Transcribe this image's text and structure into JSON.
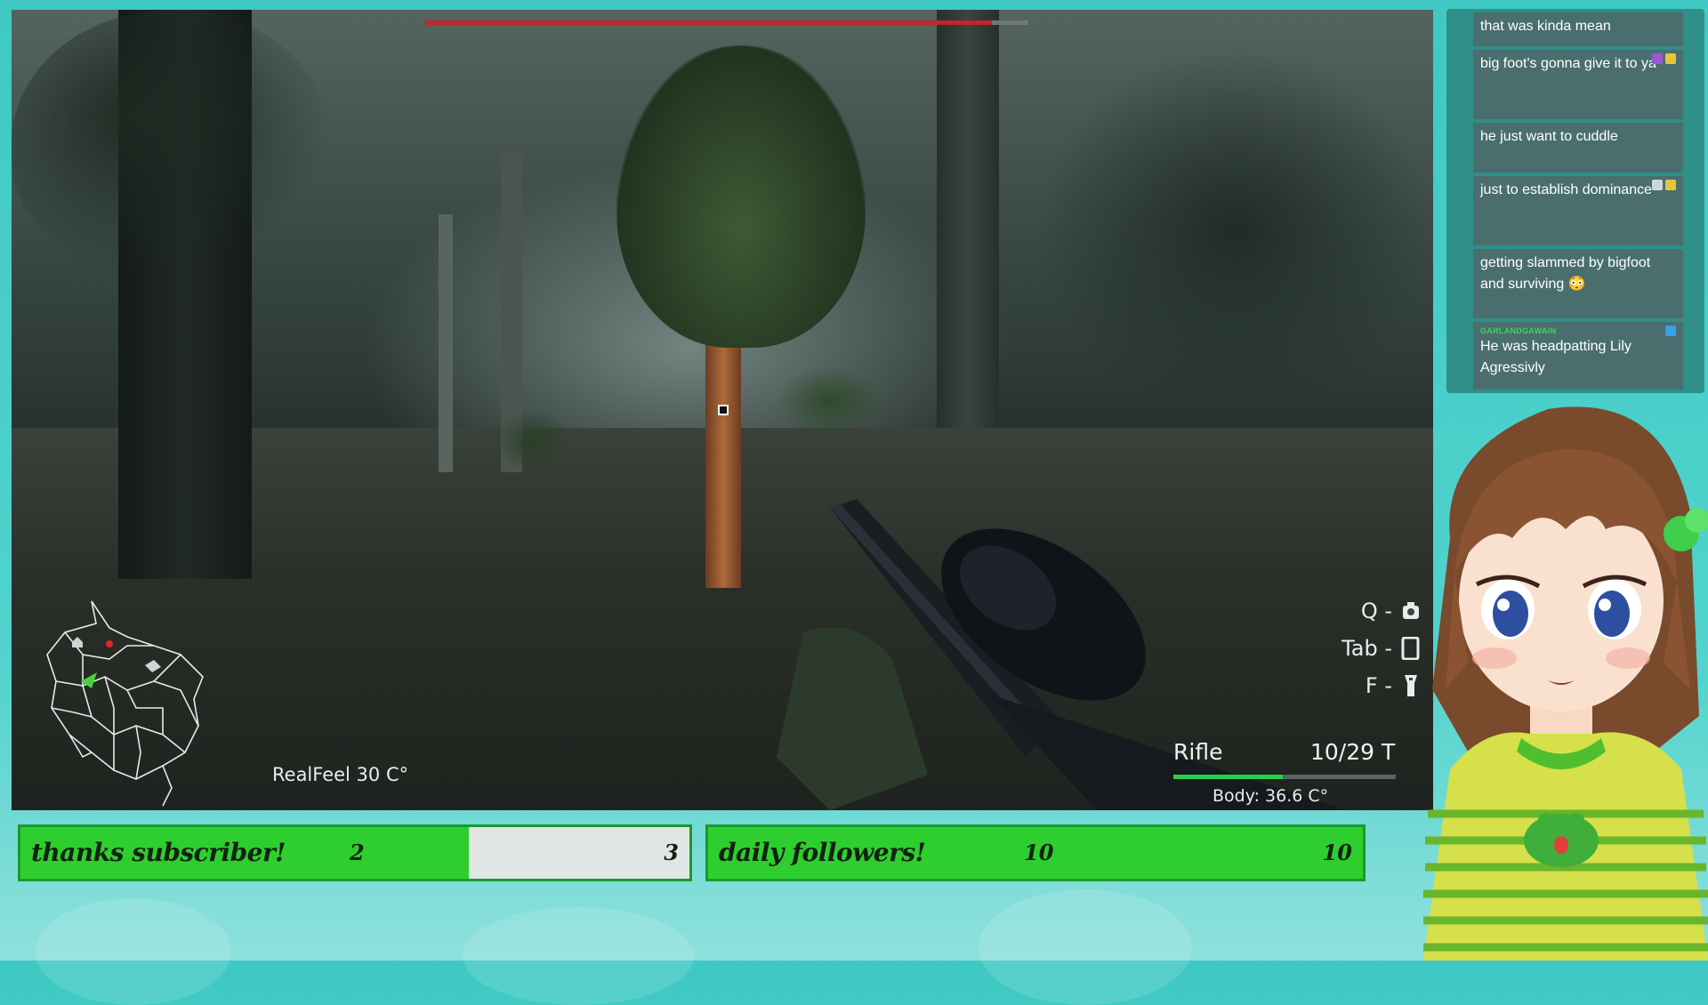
{
  "game": {
    "boss_health_pct": 94,
    "realfeel": "RealFeel  30  C°",
    "hotkeys": [
      {
        "key": "Q -",
        "icon": "camera-icon"
      },
      {
        "key": "Tab -",
        "icon": "phone-icon"
      },
      {
        "key": "F -",
        "icon": "flashlight-icon"
      }
    ],
    "weapon": "Rifle",
    "ammo": "10/29 T",
    "health_pct": 49,
    "body_temp": "Body:  36.6  C°"
  },
  "goals": [
    {
      "label": "thanks subscriber!",
      "current": "2",
      "target": "3",
      "progress": 0.67
    },
    {
      "label": "daily followers!",
      "current": "10",
      "target": "10",
      "progress": 1.0
    }
  ],
  "chat": {
    "messages": [
      {
        "user": "",
        "text": "that was kinda mean"
      },
      {
        "user": "",
        "text": "big foot's gonna give it to ya",
        "badges": [
          "#9b59d0",
          "#e8c43a"
        ]
      },
      {
        "user": "",
        "text": "he just want to cuddle"
      },
      {
        "user": "",
        "text": "just to establish dominance",
        "badges": [
          "#cfd8d8",
          "#e8c43a"
        ]
      },
      {
        "user": "",
        "text": "getting slammed by bigfoot and surviving 😳"
      },
      {
        "user": "GARLANDGAWAIN",
        "text": "He was headpatting Lily Agressivly",
        "badges": [
          "#3aa0e8"
        ]
      }
    ]
  },
  "colors": {
    "goal_green": "#2ece2f",
    "boss_red": "#c0262d",
    "hp_green": "#27d04a",
    "chat_panel": "#2f8f89"
  }
}
